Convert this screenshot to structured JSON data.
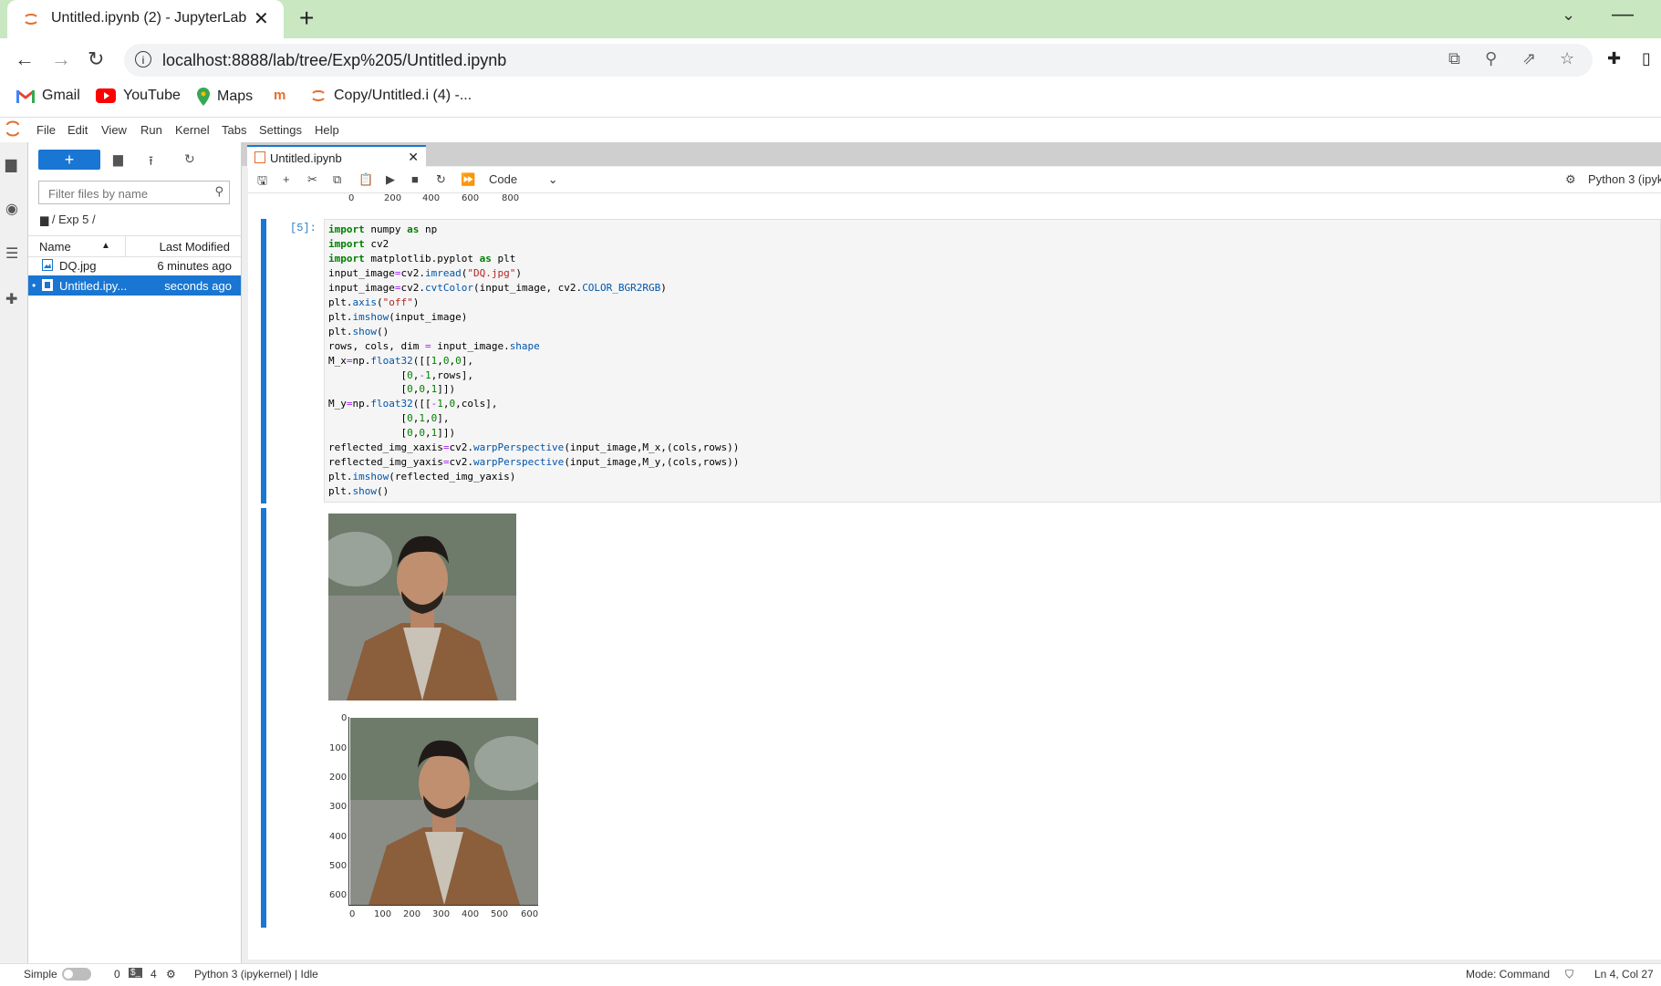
{
  "browser": {
    "tab_title": "Untitled.ipynb (2) - JupyterLab",
    "url": "localhost:8888/lab/tree/Exp%205/Untitled.ipynb",
    "bookmarks": [
      {
        "label": "Gmail",
        "icon": "gmail-icon"
      },
      {
        "label": "YouTube",
        "icon": "youtube-icon"
      },
      {
        "label": "Maps",
        "icon": "maps-icon"
      },
      {
        "label": "",
        "icon": "bookmark-m-icon"
      },
      {
        "label": "Copy/Untitled.i (4) -...",
        "icon": "jupyter-icon"
      }
    ]
  },
  "menubar": [
    "File",
    "Edit",
    "View",
    "Run",
    "Kernel",
    "Tabs",
    "Settings",
    "Help"
  ],
  "filebrowser": {
    "new_label": "+",
    "filter_placeholder": "Filter files by name",
    "breadcrumb": "/ Exp 5 /",
    "col_name": "Name",
    "col_modified": "Last Modified",
    "files": [
      {
        "name": "DQ.jpg",
        "modified": "6 minutes ago",
        "selected": false
      },
      {
        "name": "Untitled.ipy...",
        "modified": "seconds ago",
        "selected": true
      }
    ]
  },
  "notebook": {
    "tab_label": "Untitled.ipynb",
    "cell_type": "Code",
    "kernel": "Python 3 (ipyk",
    "prev_ticks": [
      "0",
      "200",
      "400",
      "600",
      "800"
    ],
    "prompt": "[5]:",
    "y_ticks": [
      "0",
      "100",
      "200",
      "300",
      "400",
      "500",
      "600"
    ],
    "x_ticks": [
      "0",
      "100",
      "200",
      "300",
      "400",
      "500",
      "600"
    ]
  },
  "status": {
    "simple": "Simple",
    "count_a": "0",
    "count_b": "4",
    "kernel_status": "Python 3 (ipykernel) | Idle",
    "mode": "Mode: Command",
    "position": "Ln 4, Col 27"
  },
  "colors": {
    "accent": "#1976d2",
    "tabstrip": "#c9e7c0"
  }
}
